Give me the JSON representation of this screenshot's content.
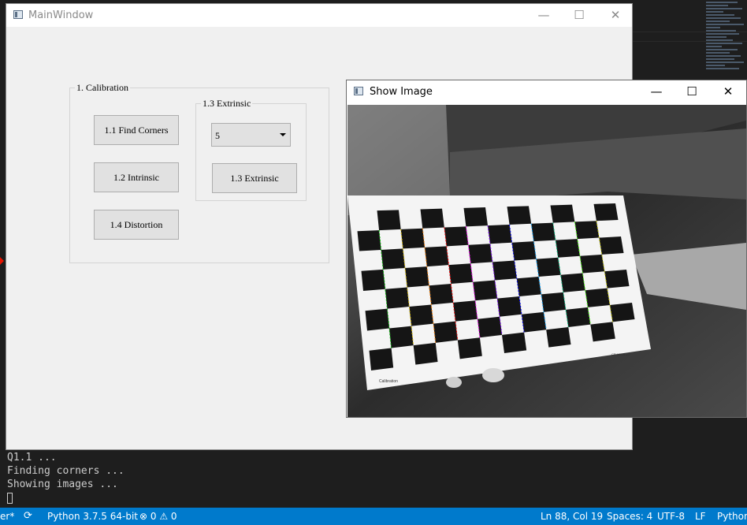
{
  "terminal": {
    "lines": [
      "Q1.1 ...",
      "Finding corners ...",
      "Showing images ..."
    ]
  },
  "statusbar": {
    "branch_suffix": "er*",
    "python": "Python 3.7.5 64-bit",
    "problems": "⊗ 0 ⚠ 0",
    "position": "Ln 88, Col 19",
    "spaces": "Spaces: 4",
    "encoding": "UTF-8",
    "eol": "LF",
    "language": "Python"
  },
  "main_window": {
    "title": "MainWindow",
    "calibration_group": {
      "title": "1. Calibration",
      "find_corners": "1.1 Find Corners",
      "intrinsic": "1.2 Intrinsic",
      "distortion": "1.4 Distortion",
      "extrinsic_group": {
        "title": "1.3 Extrinsic",
        "combo_value": "5",
        "button": "1.3 Extrinsic"
      }
    }
  },
  "image_window": {
    "title": "Show Image",
    "board_text_left": "Calibration",
    "board_text_right": "CP-189-6-20"
  },
  "colors": {
    "statusbar": "#007acc",
    "editor": "#1e1e1e"
  }
}
